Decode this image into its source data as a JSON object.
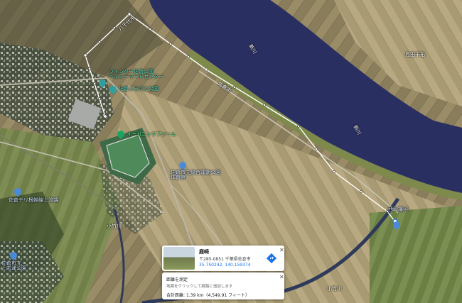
{
  "map": {
    "labels": {
      "river_main_1": "新川",
      "river_main_2": "新川",
      "river_small": "小竹川",
      "river_small_2": "小竹川",
      "road_1": "八千代市",
      "road_2": "佐倉市",
      "area_top_right": "島田干拓"
    },
    "pois": {
      "poi_1": "ウィンター佐倉公園\nヘルシーマートセンター",
      "poi_2": "佐倉ふるさと公園",
      "poi_3": "オーガニックファーム",
      "poi_4": "佐倉市立総合運動公園\n体育館",
      "poi_5": "佐倉チリ根幹線上流端",
      "poi_6": "西印旛沼",
      "poi_7": "佐倉市立\n上志津公園"
    },
    "colors": {
      "water": "#2a2f62",
      "route": "#ffffff",
      "poi_green": "#1ea362",
      "poi_blue": "#4a8bd9"
    }
  },
  "place_card": {
    "title": "鹿崎",
    "address": "〒285-0851 千葉県佐倉市",
    "coords": "35.750242, 140.159374"
  },
  "measure_card": {
    "title": "距離を測定",
    "hint": "地図をクリックして経路に追加します",
    "total_label": "合計距離",
    "total_value": "1.39 km（4,549.91 フィート）"
  }
}
